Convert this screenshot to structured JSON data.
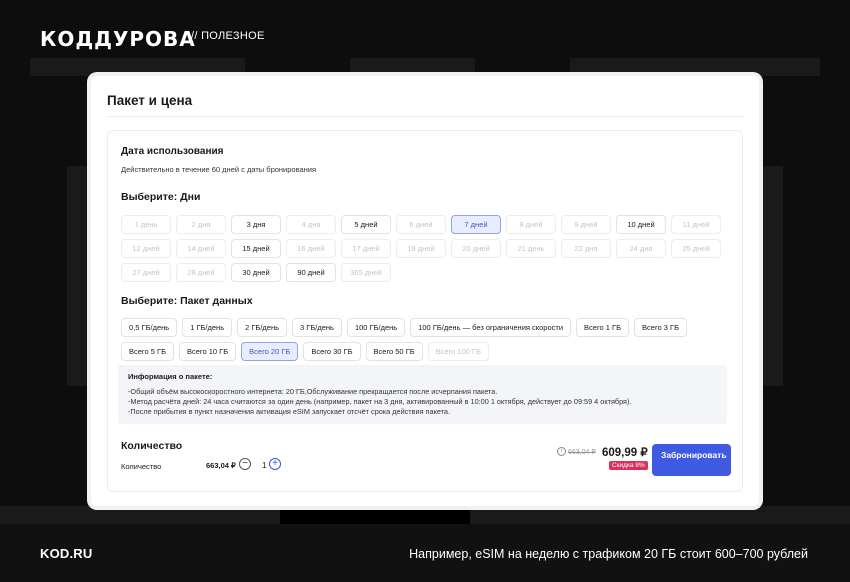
{
  "header": {
    "logo": "КОДДУРОВА",
    "subtitle": "// ПОЛЕЗНОЕ"
  },
  "card": {
    "title": "Пакет и цена",
    "usage_title": "Дата использования",
    "usage_note": "Действительно в течение 60 дней с даты бронирования",
    "days_title": "Выберите: Дни",
    "days": [
      {
        "label": "1 день",
        "state": "disabled"
      },
      {
        "label": "2 дня",
        "state": "disabled"
      },
      {
        "label": "3 дня",
        "state": "enabled"
      },
      {
        "label": "4 дня",
        "state": "disabled"
      },
      {
        "label": "5 дней",
        "state": "enabled"
      },
      {
        "label": "6 дней",
        "state": "disabled"
      },
      {
        "label": "7 дней",
        "state": "selected"
      },
      {
        "label": "8 дней",
        "state": "disabled"
      },
      {
        "label": "9 дней",
        "state": "disabled"
      },
      {
        "label": "10 дней",
        "state": "enabled"
      },
      {
        "label": "11 дней",
        "state": "disabled"
      },
      {
        "label": "12 дней",
        "state": "disabled"
      },
      {
        "label": "14 дней",
        "state": "disabled"
      },
      {
        "label": "15 дней",
        "state": "enabled"
      },
      {
        "label": "16 дней",
        "state": "disabled"
      },
      {
        "label": "17 дней",
        "state": "disabled"
      },
      {
        "label": "18 дней",
        "state": "disabled"
      },
      {
        "label": "20 дней",
        "state": "disabled"
      },
      {
        "label": "21 день",
        "state": "disabled"
      },
      {
        "label": "22 дня",
        "state": "disabled"
      },
      {
        "label": "24 дня",
        "state": "disabled"
      },
      {
        "label": "25 дней",
        "state": "disabled"
      },
      {
        "label": "27 дней",
        "state": "disabled"
      },
      {
        "label": "28 дней",
        "state": "disabled"
      },
      {
        "label": "30 дней",
        "state": "enabled"
      },
      {
        "label": "90 дней",
        "state": "enabled"
      },
      {
        "label": "365 дней",
        "state": "disabled"
      }
    ],
    "packages_title": "Выберите: Пакет данных",
    "packages": [
      {
        "label": "0,5 ГБ/день",
        "state": "enabled"
      },
      {
        "label": "1 ГБ/день",
        "state": "enabled"
      },
      {
        "label": "2 ГБ/день",
        "state": "enabled"
      },
      {
        "label": "3 ГБ/день",
        "state": "enabled"
      },
      {
        "label": "100 ГБ/день",
        "state": "enabled"
      },
      {
        "label": "100 ГБ/день — без ограничения скорости",
        "state": "enabled"
      },
      {
        "label": "Всего 1 ГБ",
        "state": "enabled"
      },
      {
        "label": "Всего 3 ГБ",
        "state": "enabled"
      },
      {
        "label": "Всего 5 ГБ",
        "state": "enabled"
      },
      {
        "label": "Всего 10 ГБ",
        "state": "enabled"
      },
      {
        "label": "Всего 20 ГБ",
        "state": "selected"
      },
      {
        "label": "Всего 30 ГБ",
        "state": "enabled"
      },
      {
        "label": "Всего 50 ГБ",
        "state": "enabled"
      },
      {
        "label": "Всего 100 ГБ",
        "state": "disabled"
      }
    ],
    "info": {
      "title": "Информация о пакете:",
      "lines": [
        "-Общий объём высокоскоростного интернета: 20 ГБ,Обслуживание прекращается после исчерпания пакета.",
        "-Метод расчёта дней: 24 часа считаются за один день (например, пакет на 3 дня, активированный в 10:00 1 октября, действует до 09:59 4 октября).",
        "-После прибытия в пункт назначения активация eSIM запускает отсчёт срока действия пакета."
      ]
    },
    "quantity": {
      "title": "Количество",
      "label": "Количество",
      "unit_price": "663,04 ₽",
      "minus": "−",
      "value": "1",
      "plus": "+"
    },
    "price": {
      "info_icon": "i",
      "old": "663,04 ₽",
      "new": "609,99 ₽",
      "discount": "Скидка 8%",
      "book": "Забронировать"
    }
  },
  "footer": {
    "site": "KOD.RU",
    "caption": "Например, eSIM на неделю с трафиком 20 ГБ стоит 600–700 рублей"
  }
}
